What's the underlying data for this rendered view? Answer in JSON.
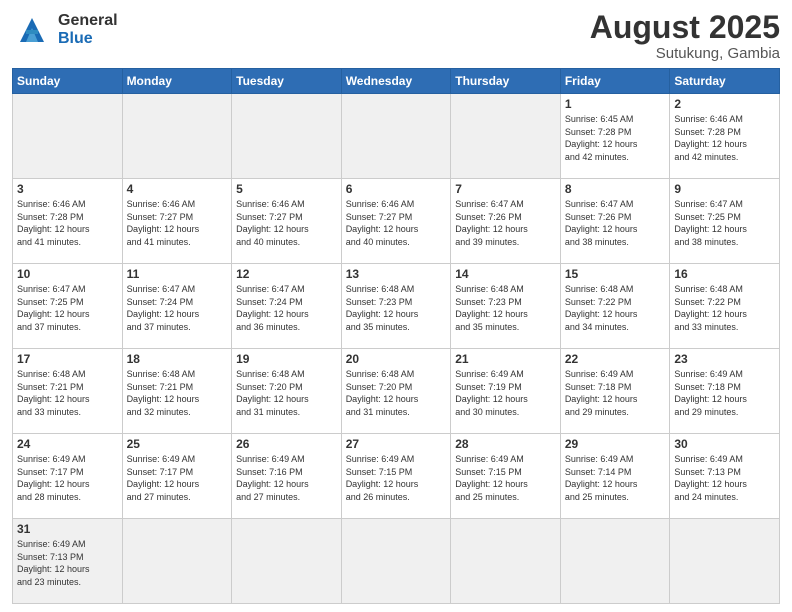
{
  "header": {
    "logo_general": "General",
    "logo_blue": "Blue",
    "month_title": "August 2025",
    "subtitle": "Sutukung, Gambia"
  },
  "days_of_week": [
    "Sunday",
    "Monday",
    "Tuesday",
    "Wednesday",
    "Thursday",
    "Friday",
    "Saturday"
  ],
  "weeks": [
    [
      {
        "day": "",
        "info": ""
      },
      {
        "day": "",
        "info": ""
      },
      {
        "day": "",
        "info": ""
      },
      {
        "day": "",
        "info": ""
      },
      {
        "day": "",
        "info": ""
      },
      {
        "day": "1",
        "info": "Sunrise: 6:45 AM\nSunset: 7:28 PM\nDaylight: 12 hours\nand 42 minutes."
      },
      {
        "day": "2",
        "info": "Sunrise: 6:46 AM\nSunset: 7:28 PM\nDaylight: 12 hours\nand 42 minutes."
      }
    ],
    [
      {
        "day": "3",
        "info": "Sunrise: 6:46 AM\nSunset: 7:28 PM\nDaylight: 12 hours\nand 41 minutes."
      },
      {
        "day": "4",
        "info": "Sunrise: 6:46 AM\nSunset: 7:27 PM\nDaylight: 12 hours\nand 41 minutes."
      },
      {
        "day": "5",
        "info": "Sunrise: 6:46 AM\nSunset: 7:27 PM\nDaylight: 12 hours\nand 40 minutes."
      },
      {
        "day": "6",
        "info": "Sunrise: 6:46 AM\nSunset: 7:27 PM\nDaylight: 12 hours\nand 40 minutes."
      },
      {
        "day": "7",
        "info": "Sunrise: 6:47 AM\nSunset: 7:26 PM\nDaylight: 12 hours\nand 39 minutes."
      },
      {
        "day": "8",
        "info": "Sunrise: 6:47 AM\nSunset: 7:26 PM\nDaylight: 12 hours\nand 38 minutes."
      },
      {
        "day": "9",
        "info": "Sunrise: 6:47 AM\nSunset: 7:25 PM\nDaylight: 12 hours\nand 38 minutes."
      }
    ],
    [
      {
        "day": "10",
        "info": "Sunrise: 6:47 AM\nSunset: 7:25 PM\nDaylight: 12 hours\nand 37 minutes."
      },
      {
        "day": "11",
        "info": "Sunrise: 6:47 AM\nSunset: 7:24 PM\nDaylight: 12 hours\nand 37 minutes."
      },
      {
        "day": "12",
        "info": "Sunrise: 6:47 AM\nSunset: 7:24 PM\nDaylight: 12 hours\nand 36 minutes."
      },
      {
        "day": "13",
        "info": "Sunrise: 6:48 AM\nSunset: 7:23 PM\nDaylight: 12 hours\nand 35 minutes."
      },
      {
        "day": "14",
        "info": "Sunrise: 6:48 AM\nSunset: 7:23 PM\nDaylight: 12 hours\nand 35 minutes."
      },
      {
        "day": "15",
        "info": "Sunrise: 6:48 AM\nSunset: 7:22 PM\nDaylight: 12 hours\nand 34 minutes."
      },
      {
        "day": "16",
        "info": "Sunrise: 6:48 AM\nSunset: 7:22 PM\nDaylight: 12 hours\nand 33 minutes."
      }
    ],
    [
      {
        "day": "17",
        "info": "Sunrise: 6:48 AM\nSunset: 7:21 PM\nDaylight: 12 hours\nand 33 minutes."
      },
      {
        "day": "18",
        "info": "Sunrise: 6:48 AM\nSunset: 7:21 PM\nDaylight: 12 hours\nand 32 minutes."
      },
      {
        "day": "19",
        "info": "Sunrise: 6:48 AM\nSunset: 7:20 PM\nDaylight: 12 hours\nand 31 minutes."
      },
      {
        "day": "20",
        "info": "Sunrise: 6:48 AM\nSunset: 7:20 PM\nDaylight: 12 hours\nand 31 minutes."
      },
      {
        "day": "21",
        "info": "Sunrise: 6:49 AM\nSunset: 7:19 PM\nDaylight: 12 hours\nand 30 minutes."
      },
      {
        "day": "22",
        "info": "Sunrise: 6:49 AM\nSunset: 7:18 PM\nDaylight: 12 hours\nand 29 minutes."
      },
      {
        "day": "23",
        "info": "Sunrise: 6:49 AM\nSunset: 7:18 PM\nDaylight: 12 hours\nand 29 minutes."
      }
    ],
    [
      {
        "day": "24",
        "info": "Sunrise: 6:49 AM\nSunset: 7:17 PM\nDaylight: 12 hours\nand 28 minutes."
      },
      {
        "day": "25",
        "info": "Sunrise: 6:49 AM\nSunset: 7:17 PM\nDaylight: 12 hours\nand 27 minutes."
      },
      {
        "day": "26",
        "info": "Sunrise: 6:49 AM\nSunset: 7:16 PM\nDaylight: 12 hours\nand 27 minutes."
      },
      {
        "day": "27",
        "info": "Sunrise: 6:49 AM\nSunset: 7:15 PM\nDaylight: 12 hours\nand 26 minutes."
      },
      {
        "day": "28",
        "info": "Sunrise: 6:49 AM\nSunset: 7:15 PM\nDaylight: 12 hours\nand 25 minutes."
      },
      {
        "day": "29",
        "info": "Sunrise: 6:49 AM\nSunset: 7:14 PM\nDaylight: 12 hours\nand 25 minutes."
      },
      {
        "day": "30",
        "info": "Sunrise: 6:49 AM\nSunset: 7:13 PM\nDaylight: 12 hours\nand 24 minutes."
      }
    ],
    [
      {
        "day": "31",
        "info": "Sunrise: 6:49 AM\nSunset: 7:13 PM\nDaylight: 12 hours\nand 23 minutes."
      },
      {
        "day": "",
        "info": ""
      },
      {
        "day": "",
        "info": ""
      },
      {
        "day": "",
        "info": ""
      },
      {
        "day": "",
        "info": ""
      },
      {
        "day": "",
        "info": ""
      },
      {
        "day": "",
        "info": ""
      }
    ]
  ]
}
